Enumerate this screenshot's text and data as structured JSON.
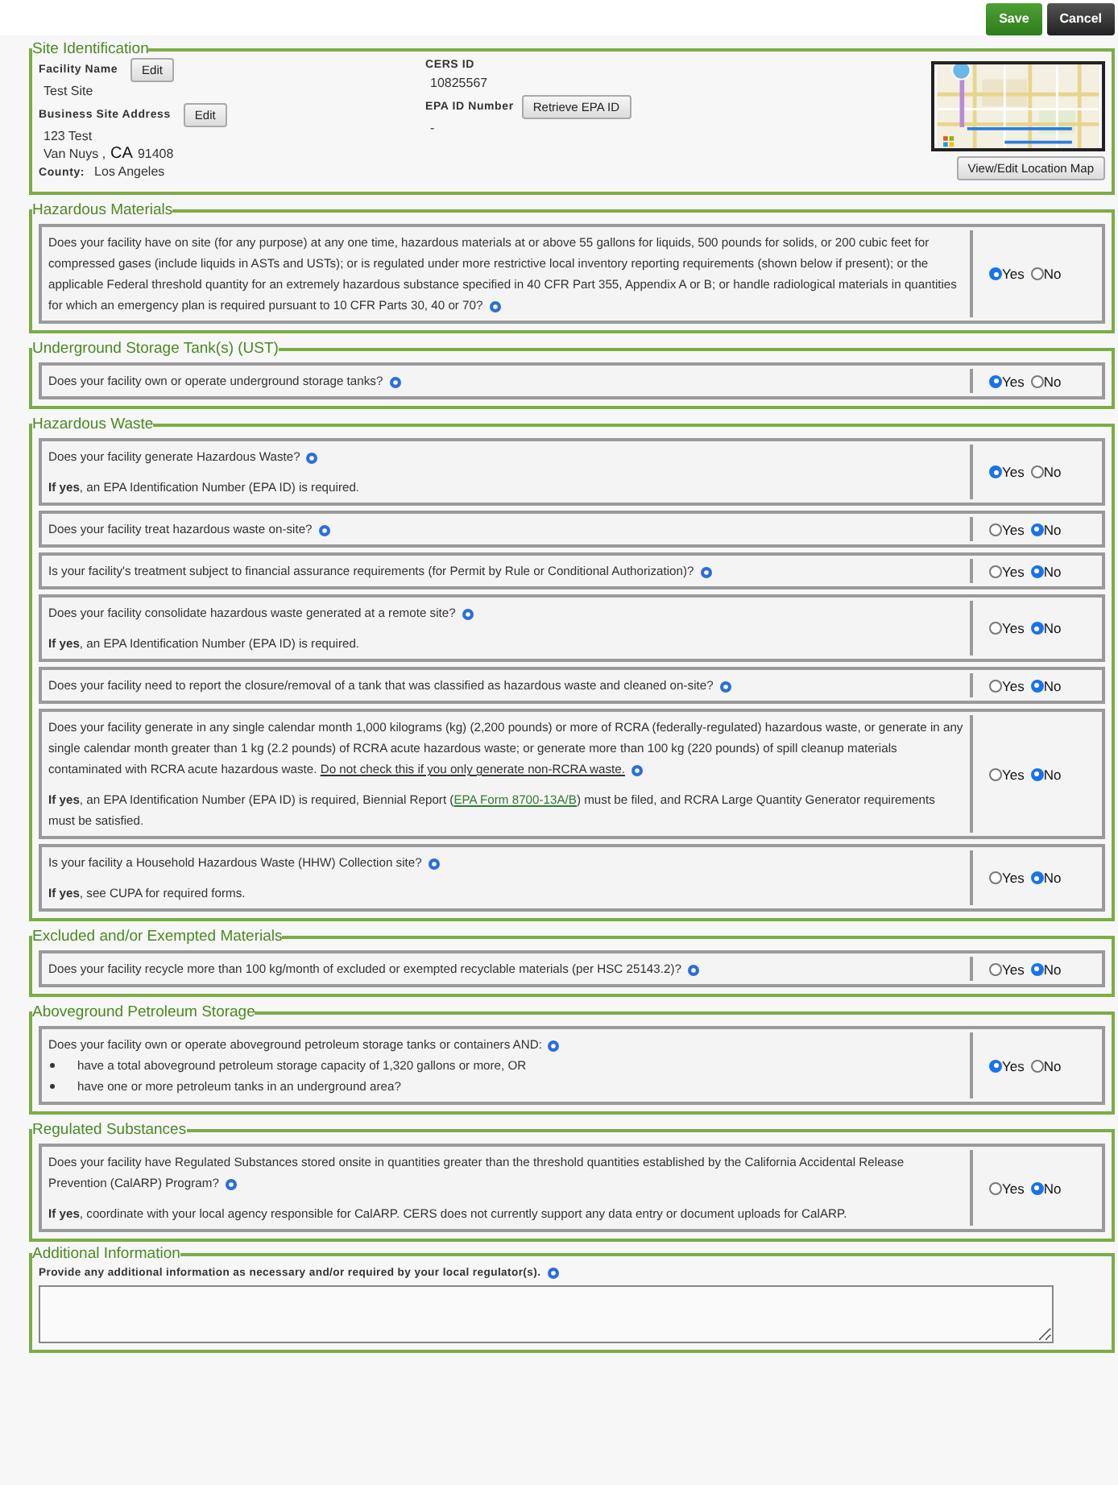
{
  "actions": [
    {
      "label": "Save",
      "kind": "primary"
    },
    {
      "label": "Cancel",
      "kind": "secondary"
    }
  ],
  "site_identification": {
    "legend": "Site Identification",
    "facility_name": {
      "label": "Facility Name",
      "button": "Edit",
      "value": "Test Site"
    },
    "business_address": {
      "label": "Business Site Address",
      "button": "Edit",
      "street": "123 Test",
      "city": "Van Nuys ,",
      "state": "CA",
      "zip": "91408"
    },
    "county": {
      "label": "County:",
      "value": "Los Angeles"
    },
    "cers_id": {
      "label": "CERS ID",
      "value": "10825567"
    },
    "epa_id": {
      "label": "EPA ID Number",
      "button": "Retrieve EPA ID",
      "value": "-"
    },
    "map": {
      "button": "View/Edit Location Map"
    }
  },
  "sections": [
    {
      "legend": "Hazardous Materials",
      "questions": [
        {
          "text": [
            {
              "kind": "text",
              "s": "Does your facility have on site (for any purpose) at any one time, hazardous materials at or above 55 gallons for liquids, 500 pounds for solids, or 200 cubic feet for compressed gases (include liquids in ASTs and USTs); or is regulated under more restrictive local inventory reporting requirements (shown below if present); or the applicable Federal threshold quantity for an extremely hazardous substance specified in 40 CFR Part 355, Appendix A or B; or handle radiological materials in quantities for which an emergency plan is required pursuant to 10 CFR Parts 30, 40 or 70?"
            }
          ],
          "options": [
            {
              "label": "Yes",
              "selected": true
            },
            {
              "label": "No",
              "selected": false
            }
          ]
        }
      ]
    },
    {
      "legend": "Underground Storage Tank(s) (UST)",
      "questions": [
        {
          "text": [
            {
              "kind": "text",
              "s": "Does your facility own or operate underground storage tanks?"
            }
          ],
          "options": [
            {
              "label": "Yes",
              "selected": true
            },
            {
              "label": "No",
              "selected": false
            }
          ]
        }
      ]
    },
    {
      "legend": "Hazardous Waste",
      "questions": [
        {
          "text": [
            {
              "kind": "text",
              "s": "Does your facility generate Hazardous Waste?"
            }
          ],
          "note": [
            {
              "kind": "text",
              "s": "**If yes**, an EPA Identification Number (EPA ID) is required."
            }
          ],
          "options": [
            {
              "label": "Yes",
              "selected": true
            },
            {
              "label": "No",
              "selected": false
            }
          ]
        },
        {
          "text": [
            {
              "kind": "text",
              "s": "Does your facility treat hazardous waste on-site?"
            }
          ],
          "options": [
            {
              "label": "Yes",
              "selected": false
            },
            {
              "label": "No",
              "selected": true
            }
          ]
        },
        {
          "text": [
            {
              "kind": "text",
              "s": "Is your facility's treatment subject to financial assurance requirements (for Permit by Rule or Conditional Authorization)?"
            }
          ],
          "options": [
            {
              "label": "Yes",
              "selected": false
            },
            {
              "label": "No",
              "selected": true
            }
          ]
        },
        {
          "text": [
            {
              "kind": "text",
              "s": "Does your facility consolidate hazardous waste generated at a remote site?"
            }
          ],
          "note": [
            {
              "kind": "text",
              "s": "**If yes**, an EPA Identification Number (EPA ID) is required."
            }
          ],
          "options": [
            {
              "label": "Yes",
              "selected": false
            },
            {
              "label": "No",
              "selected": true
            }
          ]
        },
        {
          "text": [
            {
              "kind": "text",
              "s": "Does your facility need to report the closure/removal of a tank that was classified as hazardous waste and cleaned on-site?"
            }
          ],
          "options": [
            {
              "label": "Yes",
              "selected": false
            },
            {
              "label": "No",
              "selected": true
            }
          ]
        },
        {
          "text": [
            {
              "kind": "text",
              "s": "Does your facility generate in any single calendar month 1,000 kilograms (kg) (2,200 pounds) or more of RCRA (federally-regulated) hazardous waste, or generate in any single calendar month greater than 1 kg (2.2 pounds) of RCRA acute hazardous waste; or generate more than 100 kg (220 pounds) of spill cleanup materials contaminated with RCRA acute hazardous waste. "
            },
            {
              "kind": "underline",
              "s": "Do not check this if you only generate non-RCRA waste."
            }
          ],
          "note": [
            {
              "kind": "text",
              "s": "**If yes**, an EPA Identification Number (EPA ID) is required, Biennial Report ("
            },
            {
              "kind": "link",
              "s": "EPA Form 8700-13A/B"
            },
            {
              "kind": "text",
              "s": ") must be filed, and RCRA Large Quantity Generator requirements must be satisfied."
            }
          ],
          "options": [
            {
              "label": "Yes",
              "selected": false
            },
            {
              "label": "No",
              "selected": true
            }
          ]
        },
        {
          "text": [
            {
              "kind": "text",
              "s": "Is your facility a Household Hazardous Waste (HHW) Collection site?"
            }
          ],
          "note": [
            {
              "kind": "text",
              "s": "**If yes**, see CUPA for required forms."
            }
          ],
          "options": [
            {
              "label": "Yes",
              "selected": false
            },
            {
              "label": "No",
              "selected": true
            }
          ]
        }
      ]
    },
    {
      "legend": "Excluded and/or Exempted Materials",
      "questions": [
        {
          "text": [
            {
              "kind": "text",
              "s": "Does your facility recycle more than 100 kg/month of excluded or exempted recyclable materials (per HSC 25143.2)?"
            }
          ],
          "options": [
            {
              "label": "Yes",
              "selected": false
            },
            {
              "label": "No",
              "selected": true
            }
          ]
        }
      ]
    },
    {
      "legend": "Aboveground Petroleum Storage",
      "questions": [
        {
          "text": [
            {
              "kind": "text",
              "s": "Does your facility own or operate aboveground petroleum storage tanks or containers AND:"
            }
          ],
          "bullets": [
            "have a total aboveground petroleum storage capacity of 1,320 gallons or more, OR",
            "have one or more petroleum tanks in an underground area?"
          ],
          "options": [
            {
              "label": "Yes",
              "selected": true
            },
            {
              "label": "No",
              "selected": false
            }
          ]
        }
      ]
    },
    {
      "legend": "Regulated Substances",
      "questions": [
        {
          "text": [
            {
              "kind": "text",
              "s": "Does your facility have Regulated Substances stored onsite in quantities greater than the threshold quantities established by the California Accidental Release Prevention (CalARP) Program?"
            }
          ],
          "note": [
            {
              "kind": "text",
              "s": "**If yes**, coordinate with your local agency responsible for CalARP. CERS does not currently support any data entry or document uploads for CalARP."
            }
          ],
          "options": [
            {
              "label": "Yes",
              "selected": false
            },
            {
              "label": "No",
              "selected": true
            }
          ]
        }
      ]
    }
  ],
  "additional_information": {
    "legend": "Additional Information",
    "label": "Provide any additional information as necessary and/or required by your local regulator(s)."
  }
}
